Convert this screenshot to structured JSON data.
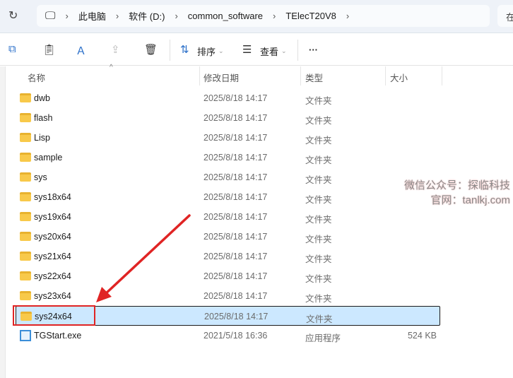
{
  "address": {
    "crumbs": [
      "此电脑",
      "软件 (D:)",
      "common_software",
      "TElecT20V8"
    ],
    "search_partial": "在"
  },
  "toolbar": {
    "sort": "排序",
    "view": "查看",
    "more": "···"
  },
  "columns": {
    "name": "名称",
    "date": "修改日期",
    "type": "类型",
    "size": "大小"
  },
  "files": [
    {
      "name": "dwb",
      "date": "2025/8/18 14:17",
      "type": "文件夹",
      "size": ""
    },
    {
      "name": "flash",
      "date": "2025/8/18 14:17",
      "type": "文件夹",
      "size": ""
    },
    {
      "name": "Lisp",
      "date": "2025/8/18 14:17",
      "type": "文件夹",
      "size": ""
    },
    {
      "name": "sample",
      "date": "2025/8/18 14:17",
      "type": "文件夹",
      "size": ""
    },
    {
      "name": "sys",
      "date": "2025/8/18 14:17",
      "type": "文件夹",
      "size": ""
    },
    {
      "name": "sys18x64",
      "date": "2025/8/18 14:17",
      "type": "文件夹",
      "size": ""
    },
    {
      "name": "sys19x64",
      "date": "2025/8/18 14:17",
      "type": "文件夹",
      "size": ""
    },
    {
      "name": "sys20x64",
      "date": "2025/8/18 14:17",
      "type": "文件夹",
      "size": ""
    },
    {
      "name": "sys21x64",
      "date": "2025/8/18 14:17",
      "type": "文件夹",
      "size": ""
    },
    {
      "name": "sys22x64",
      "date": "2025/8/18 14:17",
      "type": "文件夹",
      "size": ""
    },
    {
      "name": "sys23x64",
      "date": "2025/8/18 14:17",
      "type": "文件夹",
      "size": ""
    },
    {
      "name": "sys24x64",
      "date": "2025/8/18 14:17",
      "type": "文件夹",
      "size": "",
      "selected": true
    },
    {
      "name": "TGStart.exe",
      "date": "2021/5/18 16:36",
      "type": "应用程序",
      "size": "524 KB",
      "exe": true
    }
  ],
  "watermark": {
    "line1": "微信公众号：探临科技",
    "line2": "官网：tanlkj.com"
  },
  "colors": {
    "selection": "#cce8ff",
    "annotation": "#e02424",
    "folder": "#f8c94a"
  }
}
